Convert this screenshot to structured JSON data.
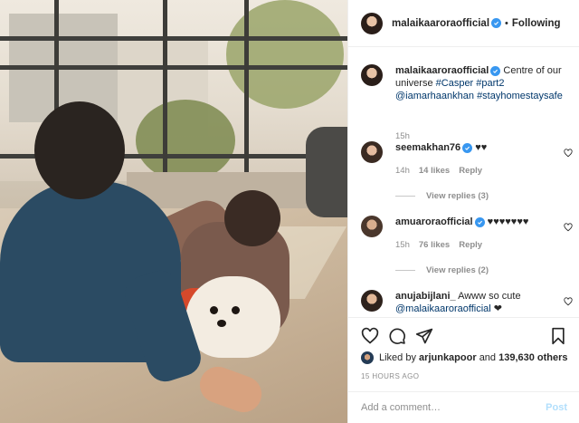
{
  "header": {
    "username": "malaikaaroraofficial",
    "separator": "•",
    "follow_label": "Following"
  },
  "caption": {
    "username": "malaikaaroraofficial",
    "text": "Centre of our universe",
    "hashtag1": "#Casper",
    "hashtag2": "#part2",
    "mention": "@iamarhaankhan",
    "hashtag3": "#stayhomestaysafe",
    "time": "15h"
  },
  "comments": [
    {
      "username": "seemakhan76",
      "text": "♥♥",
      "time": "14h",
      "likes": "14 likes",
      "reply_label": "Reply",
      "view_replies": "View replies (3)"
    },
    {
      "username": "amuaroraofficial",
      "text": "♥♥♥♥♥♥♥",
      "time": "15h",
      "likes": "76 likes",
      "reply_label": "Reply",
      "view_replies": "View replies (2)"
    },
    {
      "username": "anujabijlani_",
      "text": "Awww so cute",
      "mention": "@malaikaaroraofficial",
      "emoji": "❤"
    }
  ],
  "likes": {
    "prefix": "Liked by",
    "user": "arjunkapoor",
    "joiner": "and",
    "others": "139,630 others"
  },
  "timestamp": "15 HOURS AGO",
  "add_comment": {
    "placeholder": "Add a comment…",
    "post_label": "Post"
  },
  "colors": {
    "verified": "#3897f0",
    "link": "#00376b",
    "muted": "#8e8e8e",
    "post_disabled": "#b2dffc"
  }
}
